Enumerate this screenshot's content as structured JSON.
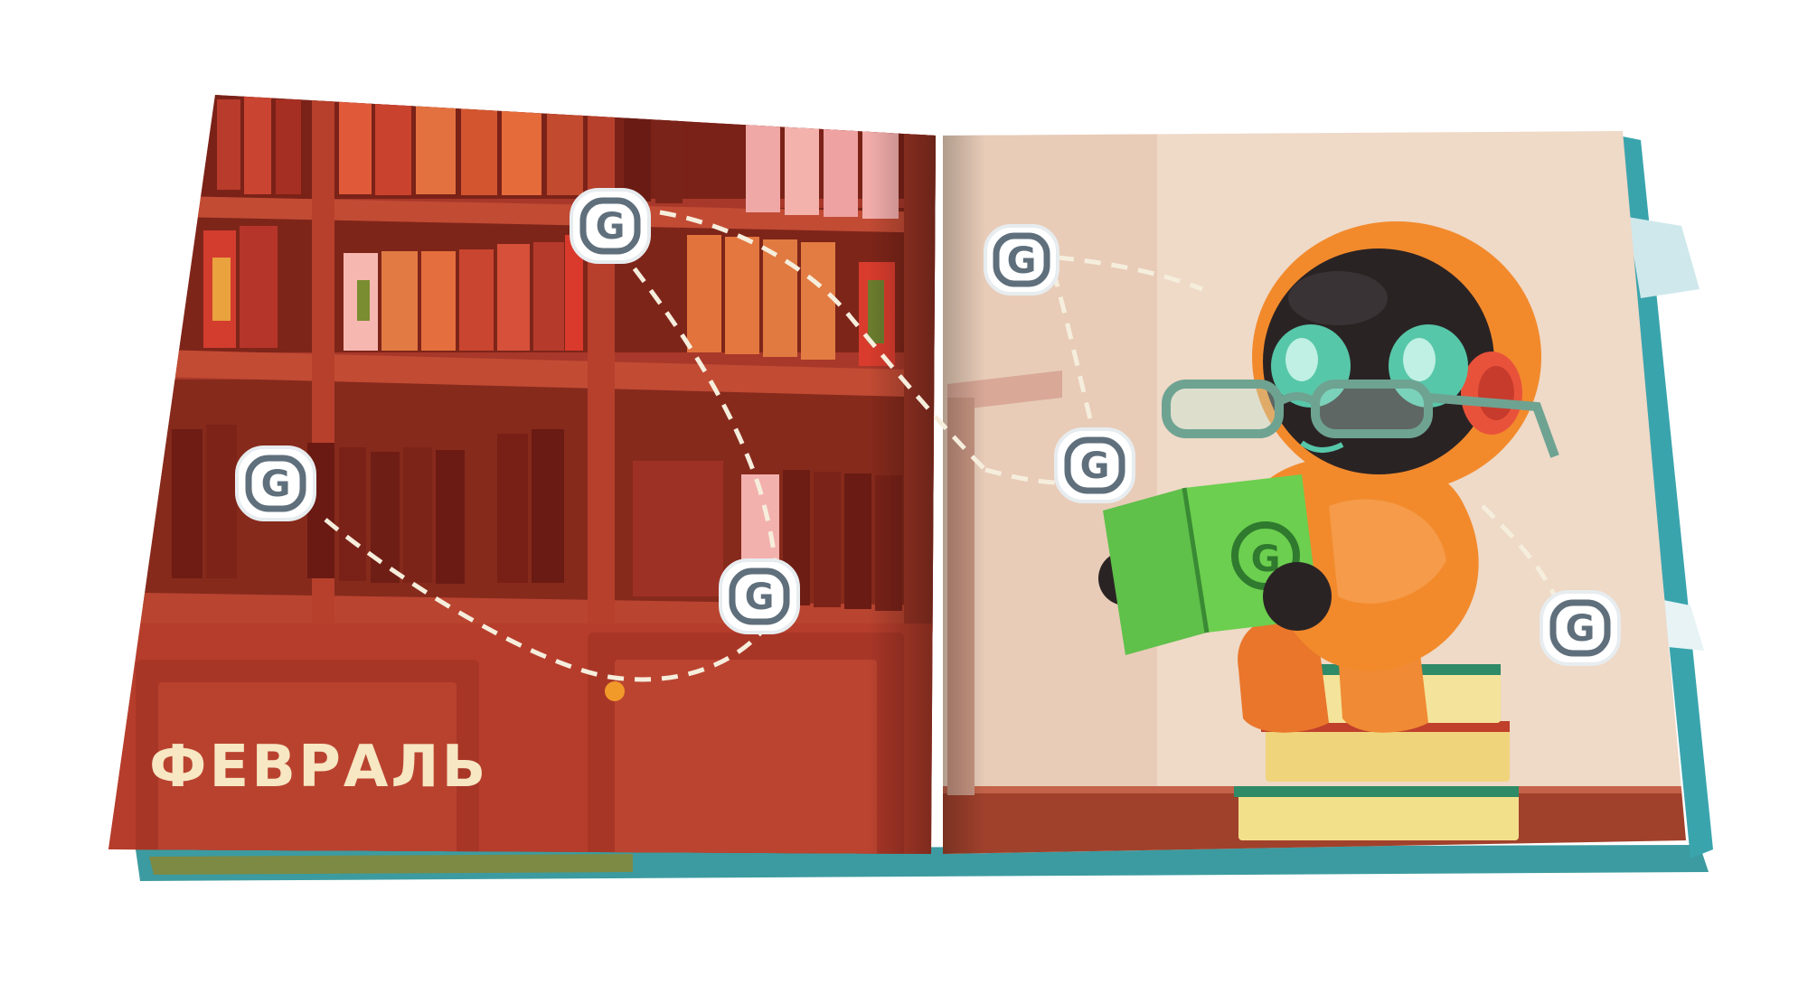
{
  "book": {
    "month_label": "ФЕВРАЛЬ",
    "badge_letter": "G",
    "book_cover_letter": "G"
  },
  "colors": {
    "label": "#f7e7c3",
    "shelf_dark": "#8e2a1d",
    "shelf_mid": "#a63a27",
    "wall": "#efd9c7",
    "floor": "#a0412c",
    "robot_orange": "#f28a2c",
    "robot_dark": "#2a2324",
    "glasses": "#6ea392",
    "book_green": "#6ccf4f",
    "badge_fill": "#ffffff",
    "badge_ring": "#5f6f7c",
    "dashes": "#f6eedd"
  },
  "icons": {
    "badge": "g-coin-icon",
    "robot": "robot-reading-icon"
  }
}
